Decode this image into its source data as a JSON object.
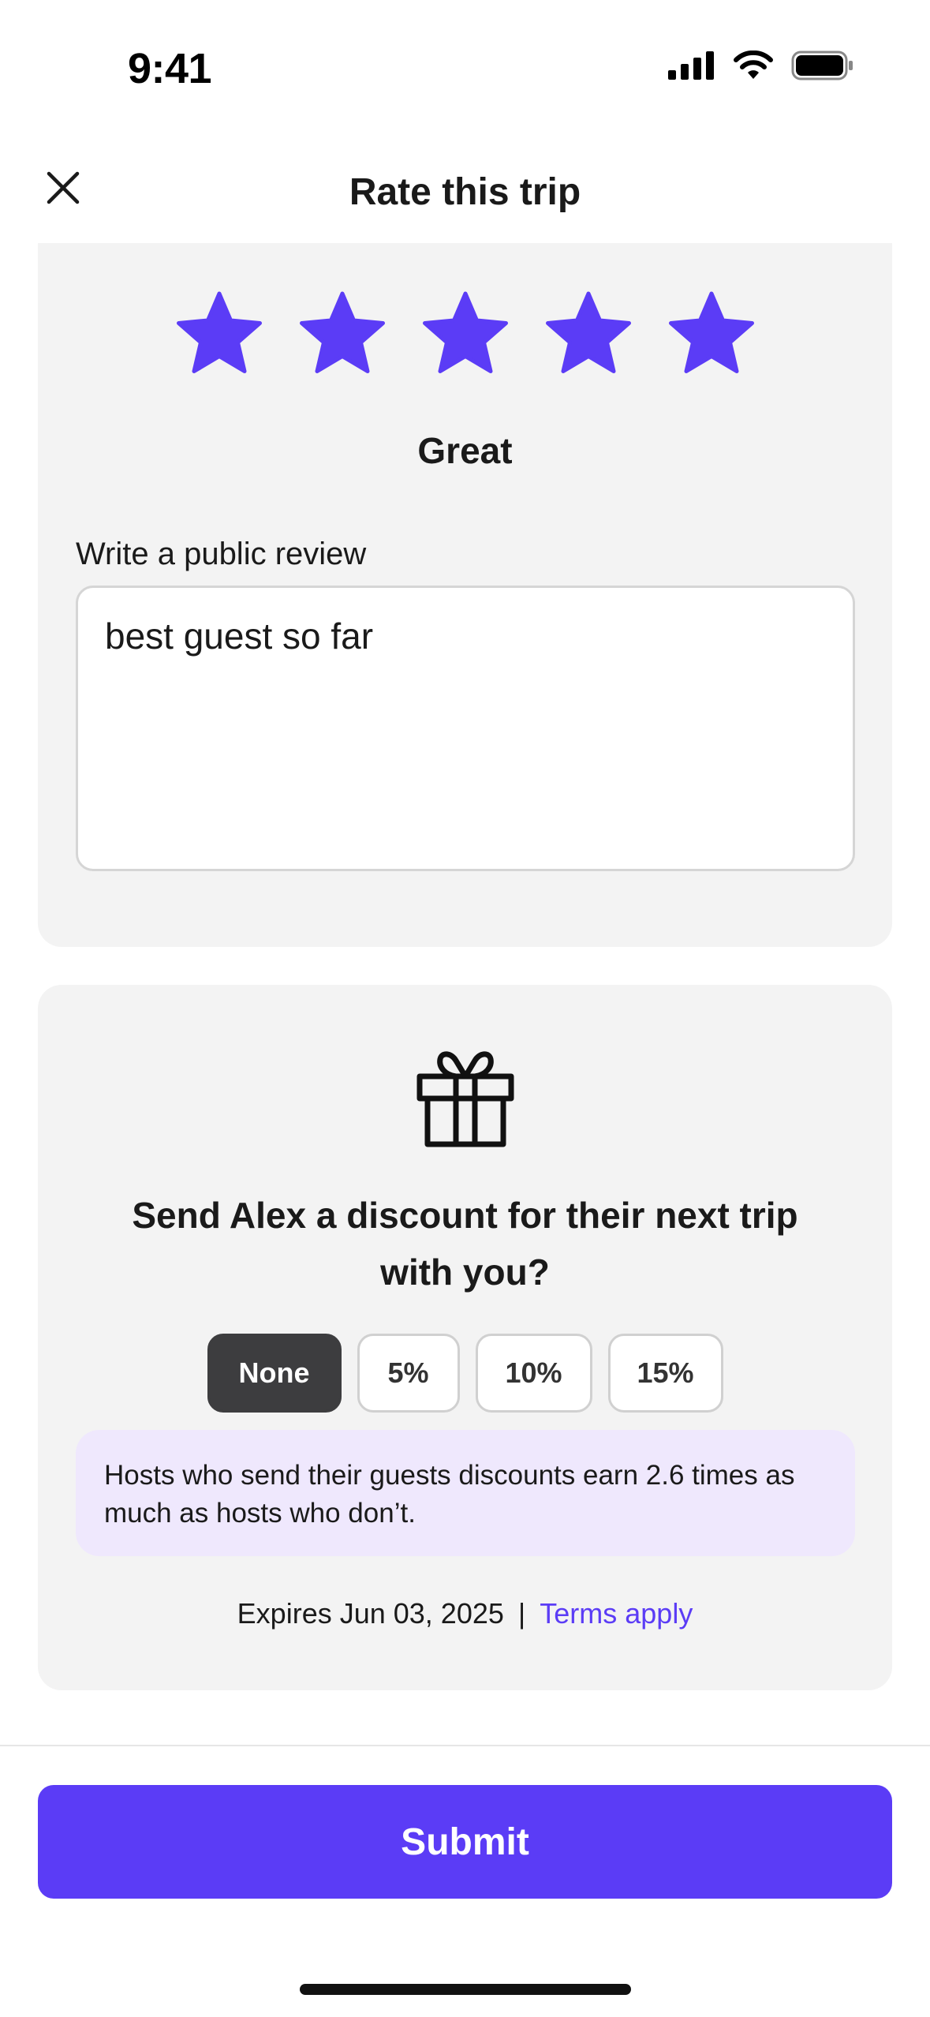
{
  "status_bar": {
    "time": "9:41"
  },
  "header": {
    "title": "Rate this trip"
  },
  "rating": {
    "stars_selected": 5,
    "stars_total": 5,
    "star_color": "#5b3cf6",
    "label": "Great"
  },
  "review": {
    "label": "Write a public review",
    "value": "best guest so far"
  },
  "discount": {
    "title": "Send Alex a discount for their next trip with you?",
    "options": [
      {
        "label": "None",
        "selected": true
      },
      {
        "label": "5%",
        "selected": false
      },
      {
        "label": "10%",
        "selected": false
      },
      {
        "label": "15%",
        "selected": false
      }
    ],
    "info": "Hosts who send their guests discounts earn 2.6 times as much as hosts who don’t.",
    "expires": "Expires Jun 03, 2025",
    "separator": "|",
    "terms_link": "Terms apply"
  },
  "footer": {
    "submit_label": "Submit"
  },
  "colors": {
    "accent": "#5b3cf6",
    "selected_option": "#3d3d3f",
    "card_bg": "#f3f3f3",
    "info_bg": "#efe8fd"
  },
  "icons": {
    "close": "close-icon",
    "star": "star-icon",
    "gift": "gift-icon",
    "signal": "signal-icon",
    "wifi": "wifi-icon",
    "battery": "battery-icon"
  }
}
